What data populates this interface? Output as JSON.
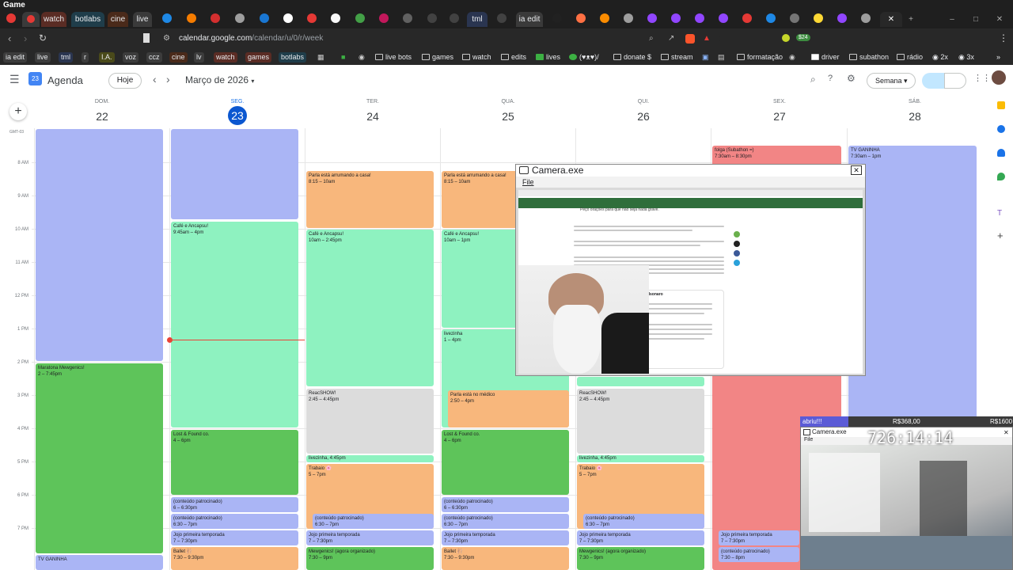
{
  "window": {
    "title": "Game"
  },
  "tabs": [
    {
      "label": "watch",
      "x": "",
      "color": "#5a2c24"
    },
    {
      "label": "botlabs",
      "color": "#1f3d4a"
    },
    {
      "label": "cine",
      "color": "#4a2a1a"
    },
    {
      "label": "live",
      "color": "#3a3a3a"
    },
    {
      "label": "tml",
      "color": "#2a3550"
    },
    {
      "label": "ia edit",
      "color": "#3a3a3a"
    }
  ],
  "browser": {
    "url_host": "calendar.google.com",
    "url_path": "/calendar/u/0/r/week",
    "badge": "$24"
  },
  "bookmarks": [
    {
      "label": "ia edit"
    },
    {
      "label": "live"
    },
    {
      "label": "tml"
    },
    {
      "label": "r"
    },
    {
      "label": "I.A."
    },
    {
      "label": "voz"
    },
    {
      "label": "ccz"
    },
    {
      "label": "cine"
    },
    {
      "label": "lv"
    },
    {
      "label": "watch"
    },
    {
      "label": "games"
    },
    {
      "label": "botlabs"
    }
  ],
  "folders": [
    {
      "label": "live bots"
    },
    {
      "label": "games"
    },
    {
      "label": "watch"
    },
    {
      "label": "edits"
    },
    {
      "label": "lives"
    },
    {
      "label": "(♥ᴥ♥)/"
    },
    {
      "label": "donate $"
    },
    {
      "label": "stream"
    },
    {
      "label": "formatação"
    },
    {
      "label": "driver"
    },
    {
      "label": "subathon"
    },
    {
      "label": "rádio"
    },
    {
      "label": "2x"
    },
    {
      "label": "3x"
    }
  ],
  "calendar": {
    "app_name": "Agenda",
    "app_icon_day": "23",
    "today_label": "Hoje",
    "month_label": "Março de 2026",
    "view_label": "Semana",
    "timezone": "GMT-03",
    "days": [
      {
        "name": "DOM.",
        "num": "22"
      },
      {
        "name": "SEG.",
        "num": "23",
        "today": true
      },
      {
        "name": "TER.",
        "num": "24"
      },
      {
        "name": "QUA.",
        "num": "25"
      },
      {
        "name": "QUI.",
        "num": "26"
      },
      {
        "name": "SEX.",
        "num": "27"
      },
      {
        "name": "SÁB.",
        "num": "28"
      }
    ],
    "hours": [
      "8 AM",
      "9 AM",
      "10 AM",
      "11 AM",
      "12 PM",
      "1 PM",
      "2 PM",
      "3 PM",
      "4 PM",
      "5 PM",
      "6 PM",
      "7 PM"
    ],
    "events": [
      {
        "title": "Maratona Mewgenics!",
        "time": "2 – 7:45pm",
        "color": "green"
      },
      {
        "title": "TV GANINHA",
        "time": "",
        "color": "blue"
      },
      {
        "title": "Café e Ancapsu!",
        "time": "9:45am – 4pm",
        "color": "mint"
      },
      {
        "title": "Lost & Found co.",
        "time": "4 – 6pm",
        "color": "green"
      },
      {
        "title": "(conteúdo patrocinado)",
        "time": "6 – 6:30pm",
        "color": "blue"
      },
      {
        "title": "(conteúdo patrocinado)",
        "time": "6:30 – 7pm",
        "color": "blue"
      },
      {
        "title": "Jojo primeira temporada",
        "time": "7 – 7:30pm",
        "color": "blue"
      },
      {
        "title": "Ballet 🩰",
        "time": "7:30 – 9:30pm",
        "color": "orange"
      },
      {
        "title": "Parla está arrumando a casa!",
        "time": "8:15 – 10am",
        "color": "orange"
      },
      {
        "title": "Café e Ancapsu!",
        "time": "10am – 2:45pm",
        "color": "mint"
      },
      {
        "title": "ReacSHOW!",
        "time": "2:45 – 4:45pm",
        "color": "grey"
      },
      {
        "title": "livezinha, 4:45pm",
        "time": "",
        "color": "mint"
      },
      {
        "title": "Trabaio 🌸",
        "time": "5 – 7pm",
        "color": "orange"
      },
      {
        "title": "(conteúdo patrocinado)",
        "time": "6:30 – 7pm",
        "color": "blue"
      },
      {
        "title": "Jojo primeira temporada",
        "time": "7 – 7:30pm",
        "color": "blue"
      },
      {
        "title": "Mewgenics! (agora organizado)",
        "time": "7:30 – 9pm",
        "color": "green"
      },
      {
        "title": "Parla está arrumando a casa!",
        "time": "8:15 – 10am",
        "color": "orange"
      },
      {
        "title": "Café e Ancapsu!",
        "time": "10am – 1pm",
        "color": "mint"
      },
      {
        "title": "livezinha",
        "time": "1 – 4pm",
        "color": "mint"
      },
      {
        "title": "Parla está no médico",
        "time": "2:50 – 4pm",
        "color": "orange"
      },
      {
        "title": "Lost & Found co.",
        "time": "4 – 6pm",
        "color": "green"
      },
      {
        "title": "(conteúdo patrocinado)",
        "time": "6 – 6:30pm",
        "color": "blue"
      },
      {
        "title": "(conteúdo patrocinado)",
        "time": "6:30 – 7pm",
        "color": "blue"
      },
      {
        "title": "Jojo primeira temporada",
        "time": "7 – 7:30pm",
        "color": "blue"
      },
      {
        "title": "Ballet 🩰",
        "time": "7:30 – 9:30pm",
        "color": "orange"
      },
      {
        "title": "ReacSHOW!",
        "time": "2:45 – 4:45pm",
        "color": "grey"
      },
      {
        "title": "livezinha, 4:45pm",
        "time": "",
        "color": "mint"
      },
      {
        "title": "Trabaio 🌸",
        "time": "5 – 7pm",
        "color": "orange"
      },
      {
        "title": "(conteúdo patrocinado)",
        "time": "6:30 – 7pm",
        "color": "blue"
      },
      {
        "title": "Jojo primeira temporada",
        "time": "7 – 7:30pm",
        "color": "blue"
      },
      {
        "title": "Mewgenics! (agora organizado)",
        "time": "7:30 – 9pm",
        "color": "green"
      },
      {
        "title": "folga (Subathon =)",
        "time": "7:30am – 8:30pm",
        "color": "red"
      },
      {
        "title": "Jojo primeira temporada",
        "time": "7 – 7:30pm",
        "color": "blue"
      },
      {
        "title": "(conteúdo patrocinado)",
        "time": "7:30 – 8pm",
        "color": "blue"
      },
      {
        "title": "TV GANINHA",
        "time": "7:30am – 1pm",
        "color": "blue"
      }
    ]
  },
  "camera_window": {
    "title": "Camera.exe",
    "menu": "File",
    "page_text": [
      "Peço orações para que não seja nada grave.",
      "Carlos Bolsonaro"
    ]
  },
  "stream_overlay": {
    "goal_label": "abriu!!!",
    "amount_mid": "R$368,00",
    "amount_right": "R$1600",
    "timer": "726:14:14",
    "cam_title": "Camera.exe",
    "cam_menu": "File"
  }
}
